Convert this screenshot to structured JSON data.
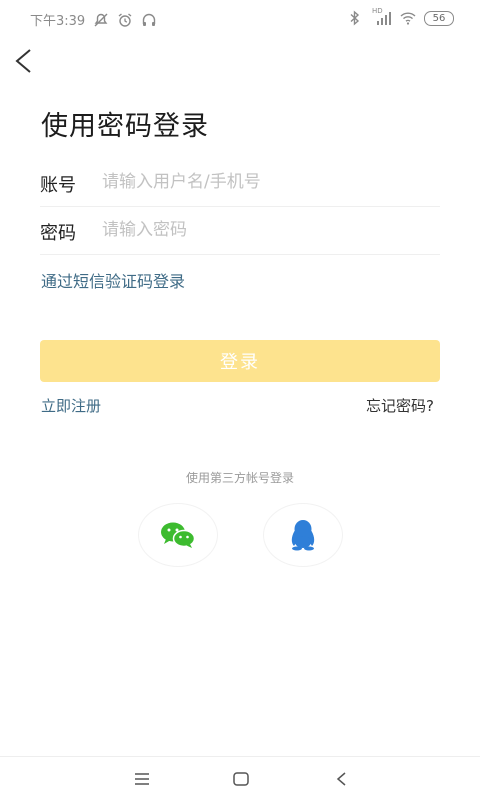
{
  "status_bar": {
    "time": "下午3:39",
    "signal_label": "HD",
    "battery": "56"
  },
  "header": {
    "title": "使用密码登录"
  },
  "form": {
    "account_label": "账号",
    "account_placeholder": "请输入用户名/手机号",
    "account_value": "",
    "password_label": "密码",
    "password_placeholder": "请输入密码",
    "password_value": ""
  },
  "sms_login_link": "通过短信验证码登录",
  "login_button": "登录",
  "register_link": "立即注册",
  "forgot_password_link": "忘记密码?",
  "third_party": {
    "label": "使用第三方帐号登录",
    "providers": [
      "wechat",
      "qq"
    ]
  },
  "colors": {
    "accent_link": "#3f6b86",
    "login_button_bg": "#fde38e",
    "wechat_green": "#3dbb2f",
    "qq_blue": "#2f7fd8"
  },
  "icons": {
    "back": "chevron-left-icon",
    "wechat": "wechat-icon",
    "qq": "qq-penguin-icon",
    "nav_menu": "menu-icon",
    "nav_home": "home-square-icon",
    "nav_back": "back-triangle-icon"
  }
}
